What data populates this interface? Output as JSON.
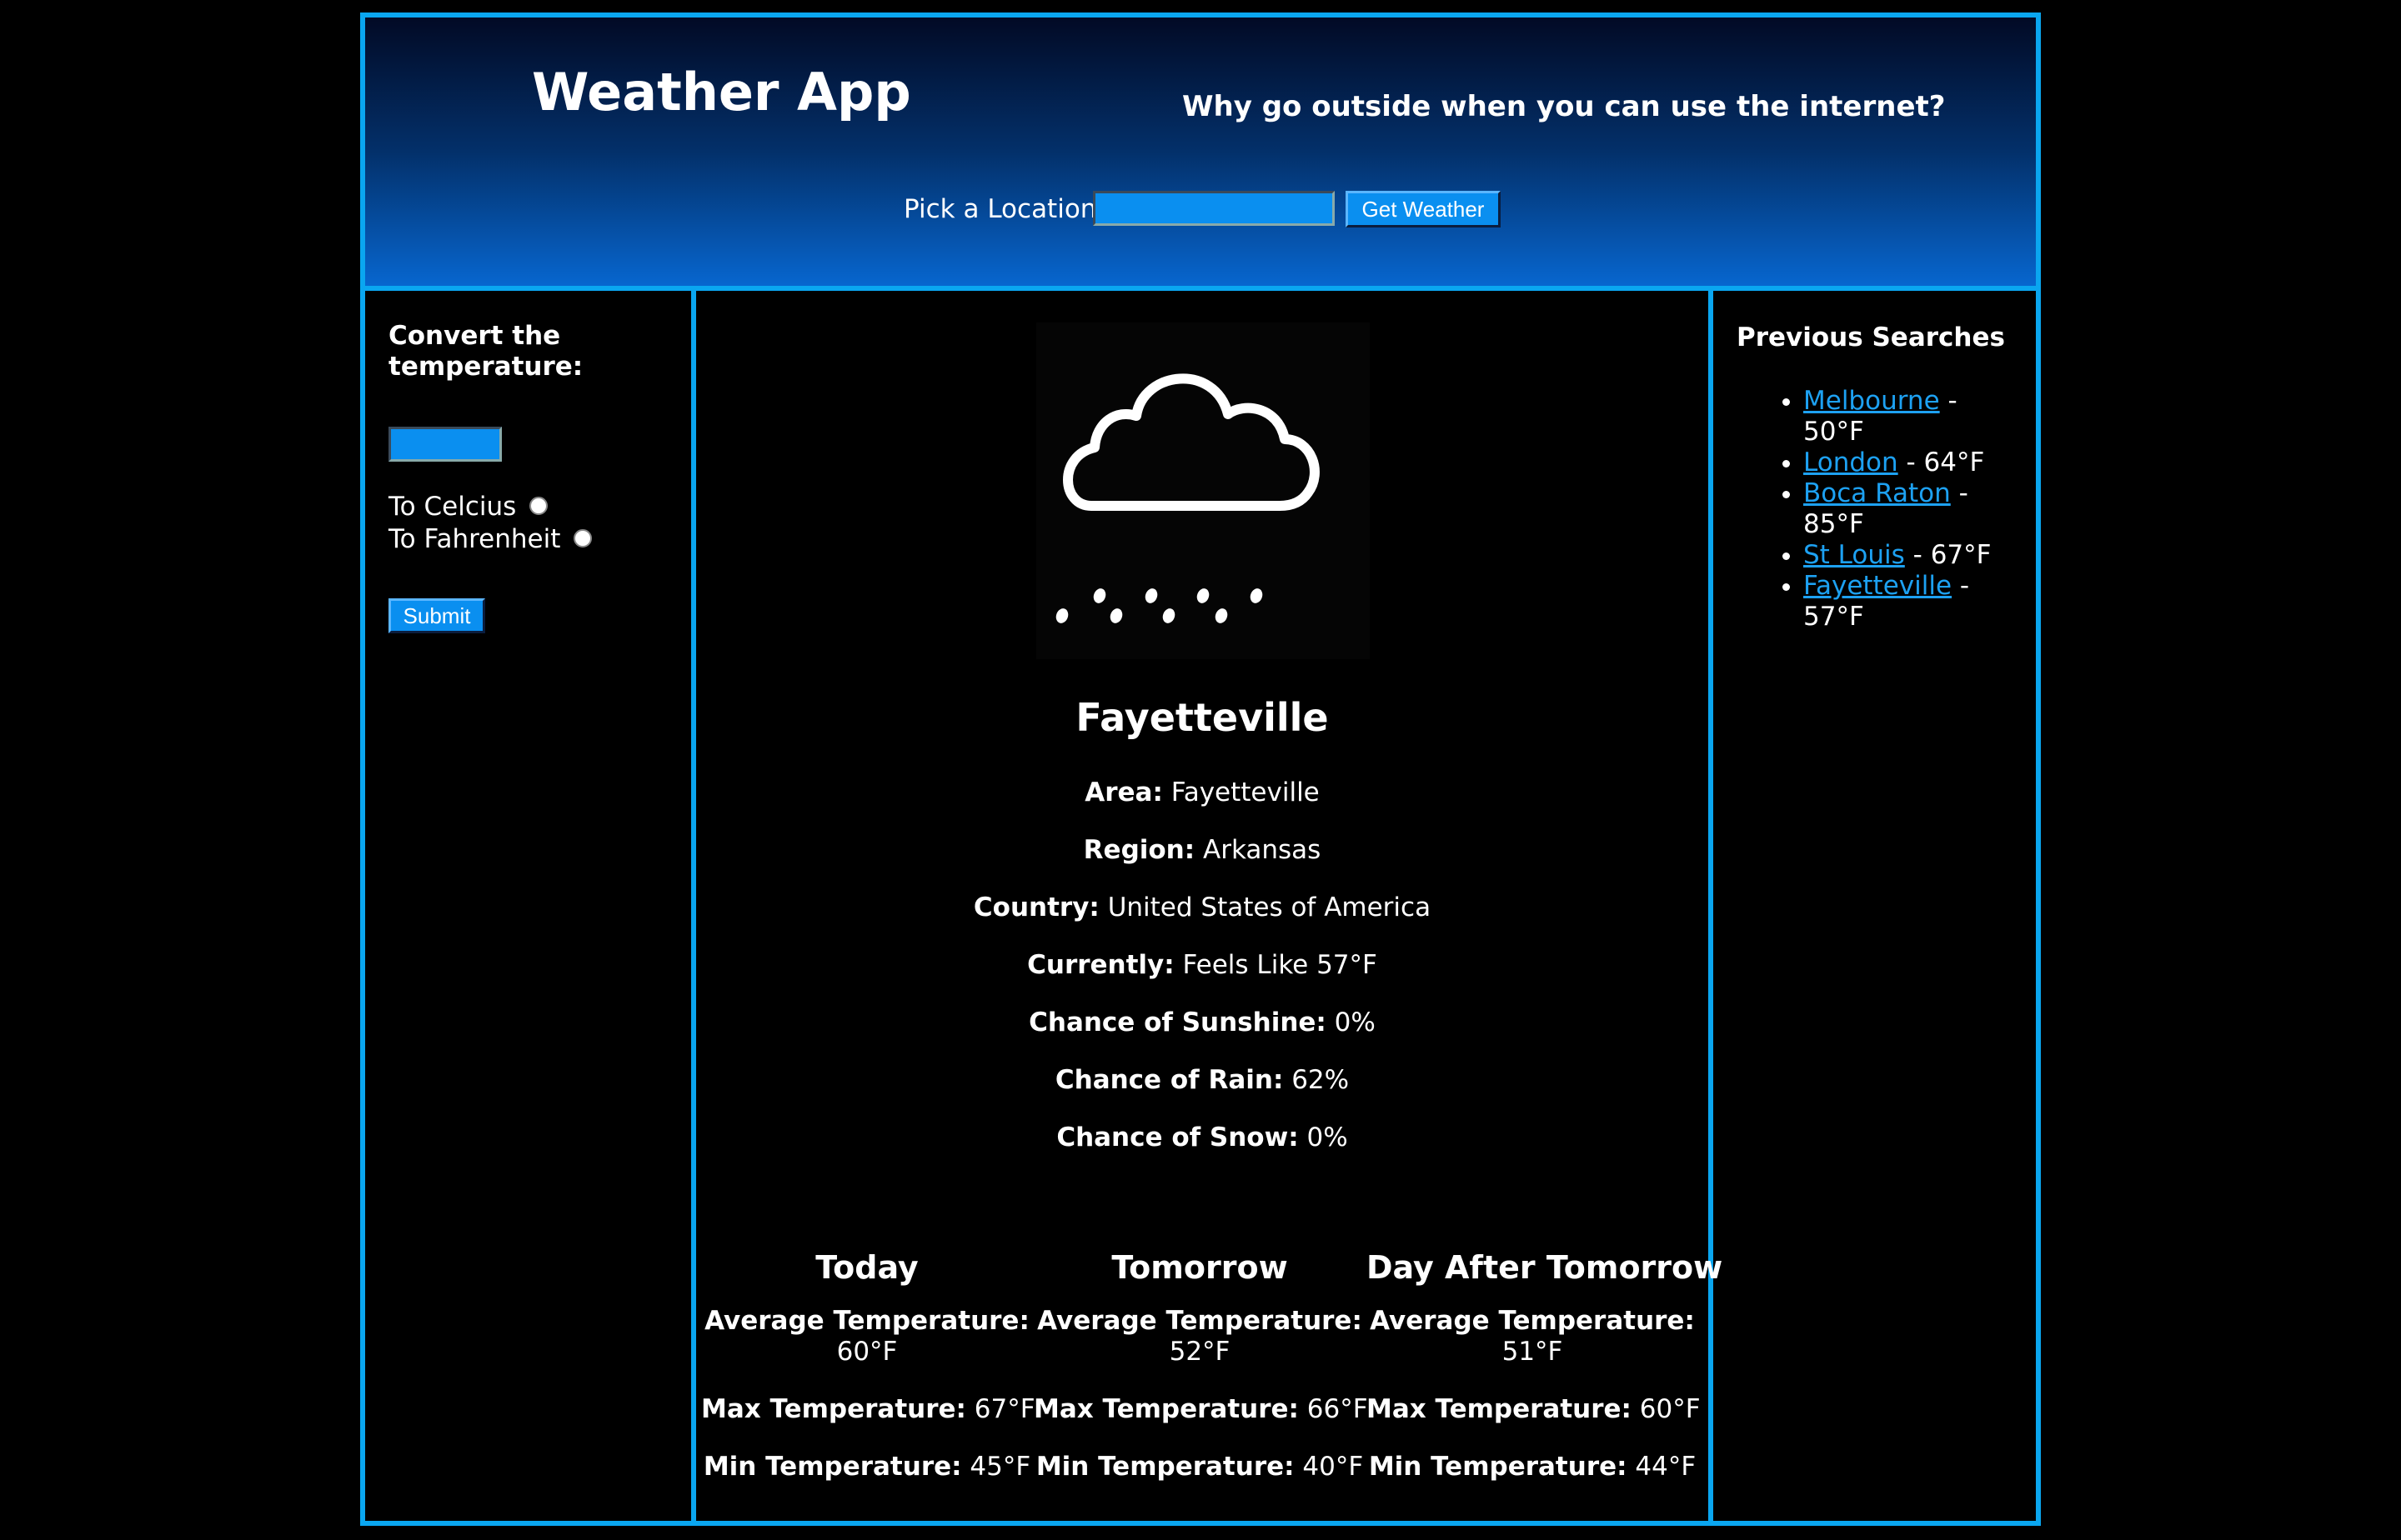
{
  "header": {
    "title": "Weather App",
    "tagline": "Why go outside when you can use the internet?",
    "search_label": "Pick a Location",
    "search_value": "",
    "get_weather_label": "Get Weather"
  },
  "converter": {
    "heading": "Convert the temperature:",
    "input_value": "",
    "to_celsius_label": "To Celcius",
    "to_fahrenheit_label": "To Fahrenheit",
    "submit_label": "Submit"
  },
  "current": {
    "icon": "cloud-rain-icon",
    "city": "Fayetteville",
    "area_label": "Area:",
    "area_value": "Fayetteville",
    "region_label": "Region:",
    "region_value": "Arkansas",
    "country_label": "Country:",
    "country_value": "United States of America",
    "currently_label": "Currently:",
    "currently_value": "Feels Like 57°F",
    "sunshine_label": "Chance of Sunshine:",
    "sunshine_value": "0%",
    "rain_label": "Chance of Rain:",
    "rain_value": "62%",
    "snow_label": "Chance of Snow:",
    "snow_value": "0%"
  },
  "forecast": [
    {
      "title": "Today",
      "avg_label": "Average Temperature:",
      "avg_value": "60°F",
      "max_label": "Max Temperature:",
      "max_value": "67°F",
      "min_label": "Min Temperature:",
      "min_value": "45°F"
    },
    {
      "title": "Tomorrow",
      "avg_label": "Average Temperature:",
      "avg_value": "52°F",
      "max_label": "Max Temperature:",
      "max_value": "66°F",
      "min_label": "Min Temperature:",
      "min_value": "40°F"
    },
    {
      "title": "Day After Tomorrow",
      "avg_label": "Average Temperature:",
      "avg_value": "51°F",
      "max_label": "Max Temperature:",
      "max_value": "60°F",
      "min_label": "Min Temperature:",
      "min_value": "44°F"
    }
  ],
  "previous_searches": {
    "heading": "Previous Searches",
    "items": [
      {
        "city": "Melbourne",
        "temp": " - 50°F"
      },
      {
        "city": "London",
        "temp": " - 64°F"
      },
      {
        "city": "Boca Raton",
        "temp": " - 85°F"
      },
      {
        "city": "St Louis",
        "temp": " - 67°F"
      },
      {
        "city": "Fayetteville",
        "temp": " - 57°F"
      }
    ]
  },
  "colors": {
    "accent": "#0aa6f0",
    "button": "#0a8ff0",
    "link": "#1da1f2",
    "header_top": "#020a25",
    "header_bottom": "#0766cf",
    "background": "#000000"
  }
}
